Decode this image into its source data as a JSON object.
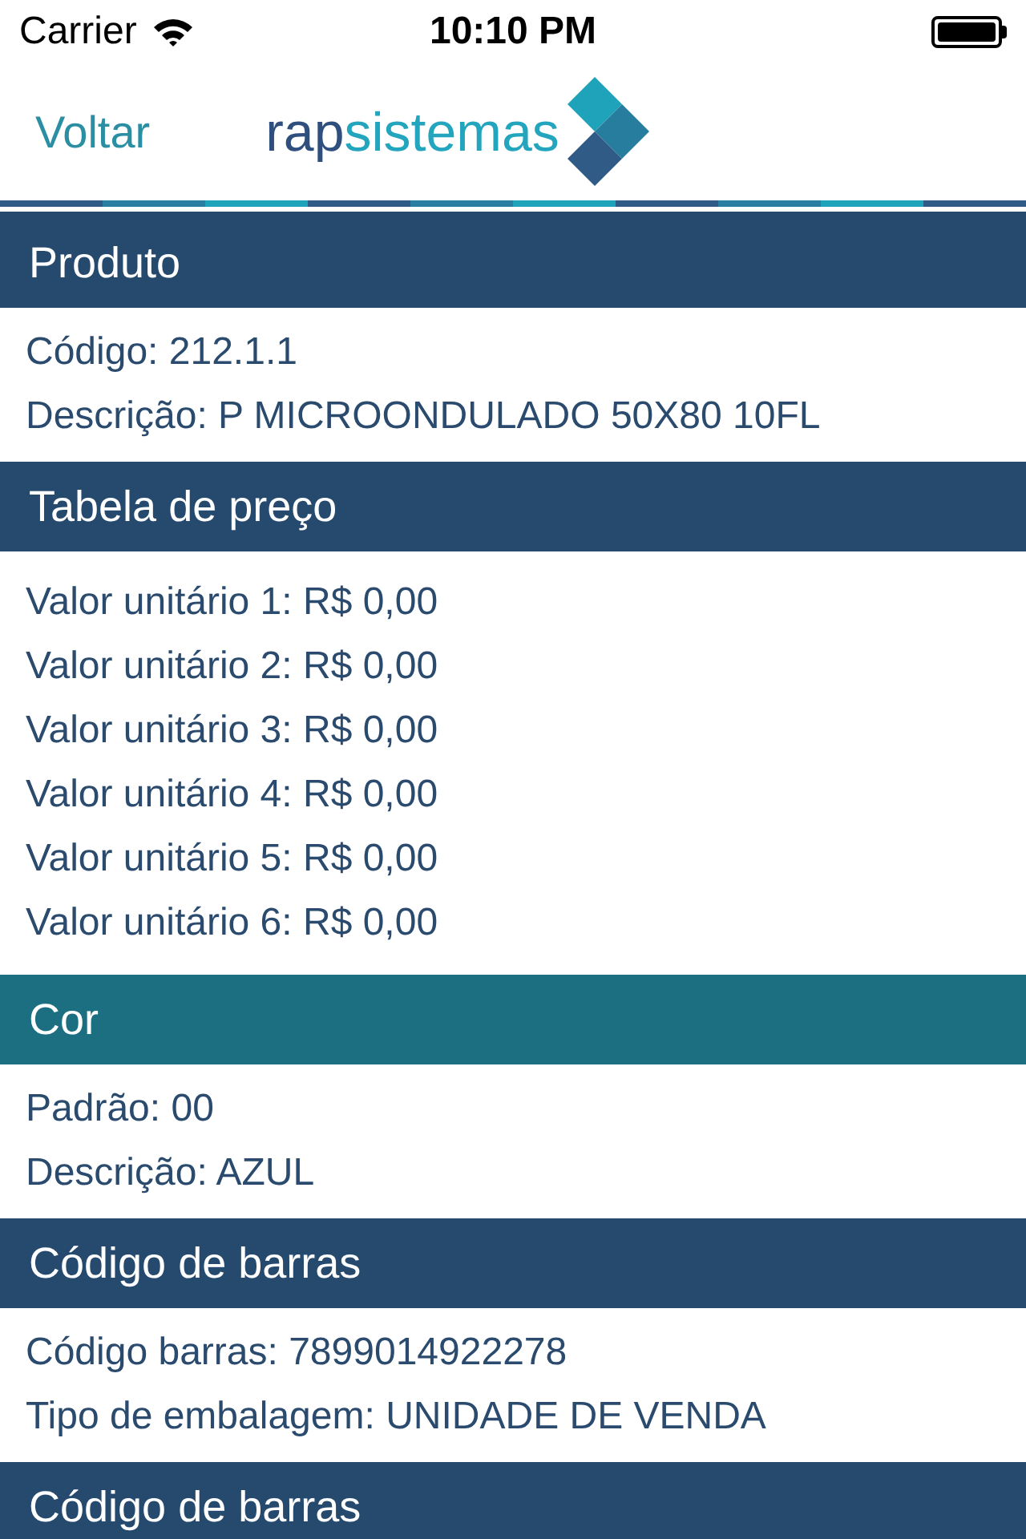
{
  "status_bar": {
    "carrier": "Carrier",
    "time": "10:10 PM"
  },
  "nav": {
    "back": "Voltar",
    "logo": {
      "dark": "rap",
      "light": "sistemas"
    }
  },
  "sections": [
    {
      "title": "Produto",
      "color": "#264a6e",
      "lines": [
        "Código: 212.1.1",
        "Descrição: P MICROONDULADO 50X80 10FL"
      ]
    },
    {
      "title": "Tabela de preço",
      "color": "#264a6e",
      "lines": [
        "Valor unitário 1: R$ 0,00",
        "Valor unitário 2: R$ 0,00",
        "Valor unitário 3: R$ 0,00",
        "Valor unitário 4: R$ 0,00",
        "Valor unitário 5: R$ 0,00",
        "Valor unitário 6: R$ 0,00"
      ]
    },
    {
      "title": "Cor",
      "color": "#1b6f80",
      "lines": [
        "Padrão: 00",
        "Descrição: AZUL"
      ]
    },
    {
      "title": "Código de barras",
      "color": "#264a6e",
      "lines": [
        "Código barras: 7899014922278",
        "Tipo de embalagem: UNIDADE DE VENDA"
      ]
    },
    {
      "title": "Código de barras",
      "color": "#264a6e"
    }
  ]
}
